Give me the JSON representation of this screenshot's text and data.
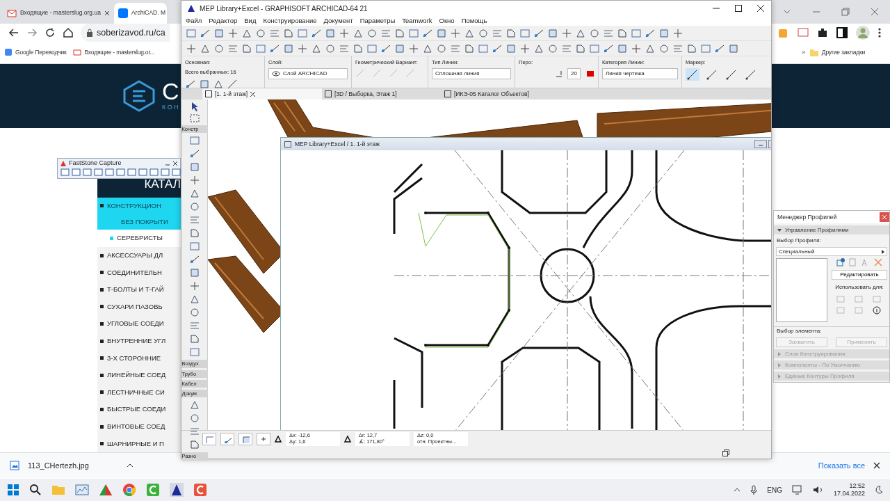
{
  "browser": {
    "tabs": [
      {
        "label": "Входящие - masterslug.org.ua",
        "selected": false
      },
      {
        "label": "ArchiCAD. M",
        "selected": true
      }
    ],
    "url": "soberizavod.ru/ca",
    "bookmarks": [
      "Google Переводчик",
      "Входящие - masterslug.or..."
    ],
    "bookmarks_more": "»",
    "other_bookmarks": "Другие закладки"
  },
  "site": {
    "logo_text": "С",
    "logo_sub": "КОН",
    "catalog_title": "КАТАЛ",
    "catalog": [
      {
        "label": "КОНСТРУКЦИОН",
        "label_2": "БЕЗ ПОКРЫТИ",
        "selected": true,
        "children": [
          {
            "label": "СЕРЕБРИСТЫ"
          }
        ]
      },
      {
        "label": "АКСЕССУАРЫ ДЛ",
        "selected": false
      },
      {
        "label": "СОЕДИНИТЕЛЬН",
        "selected": false
      },
      {
        "label": "Т-БОЛТЫ И Т-ГАЙ",
        "selected": false
      },
      {
        "label": "СУХАРИ ПАЗОВЬ",
        "selected": false
      },
      {
        "label": "УГЛОВЫЕ СОЕДИ",
        "selected": false
      },
      {
        "label": "ВНУТРЕННИЕ УГЛ",
        "selected": false
      },
      {
        "label": "3-Х СТОРОННИЕ",
        "selected": false
      },
      {
        "label": "ЛИНЕЙНЫЕ СОЕД",
        "selected": false
      },
      {
        "label": "ЛЕСТНИЧНЫЕ СИ",
        "selected": false
      },
      {
        "label": "БЫСТРЫЕ СОЕДИ",
        "selected": false
      },
      {
        "label": "ВИНТОВЫЕ СОЕД",
        "selected": false
      },
      {
        "label": "ШАРНИРНЫЕ И П",
        "selected": false
      }
    ]
  },
  "downloads": {
    "file": "113_CHertezh.jpg",
    "show_all": "Показать все"
  },
  "taskbar": {
    "lang": "ENG",
    "time": "12:52",
    "date": "17.04.2022"
  },
  "archicad": {
    "title": "MEP Library+Excel - GRAPHISOFT ARCHICAD-64 21",
    "menu": [
      "Файл",
      "Редактор",
      "Вид",
      "Конструирование",
      "Документ",
      "Параметры",
      "Teamwork",
      "Окно",
      "Помощь"
    ],
    "info_box": {
      "main_label": "Основная:",
      "selected_count": "Всего выбранных: 16",
      "layer_label": "Слой:",
      "layer": "Слой ARCHICAD",
      "geometry_label": "Геометрический Вариант:",
      "line_type_label": "Тип Линии:",
      "line_type": "Сплошная линия",
      "pen_label": "Перо:",
      "pen": "20",
      "line_category_label": "Категория Линии:",
      "line_category": "Линия чертежа",
      "marker_label": "Маркер:",
      "markers": [
        {
          "selected": true
        },
        {
          "selected": false
        },
        {
          "selected": false
        },
        {
          "selected": false
        }
      ]
    },
    "view_tabs": [
      {
        "label": "[1. 1-й этаж]",
        "selected": true
      },
      {
        "label": "[3D / Выборка, Этаж 1]",
        "selected": false
      },
      {
        "label": "[ИКЭ-05 Каталог Объектов]",
        "selected": false
      }
    ],
    "toolbox": [
      "Констр",
      "Воздух",
      "Трубо",
      "Кабел",
      "Докум",
      "Разно"
    ],
    "inner_window": {
      "title": "MEP Library+Excel / 1. 1-й этаж"
    },
    "status": {
      "dx": "Δx: -12,6",
      "dy": "Δy: 1,6",
      "dr": "Δr: 12,7",
      "angle": "∡: 171,80°",
      "dz": "Δz: 0,0",
      "reference": "отн. Проектны..."
    }
  },
  "faststone": {
    "title": "FastStone Capture"
  },
  "profile_manager": {
    "title": "Менеджер Профилей",
    "section": "Управление Профилями",
    "expanded": true,
    "profile_label": "Выбор Профиля:",
    "profile": "Специальный",
    "edit_button": "Редактировать",
    "use_for_label": "Использовать для:",
    "element_label": "Выбор элемента:",
    "buttons": [
      {
        "label": "Захватить",
        "disabled": true
      },
      {
        "label": "Применить",
        "disabled": true
      }
    ],
    "collapsed_sections": [
      "Слои Конструирования",
      "Компоненты - По Умолчанию",
      "Единые Контуры Профиля"
    ]
  }
}
